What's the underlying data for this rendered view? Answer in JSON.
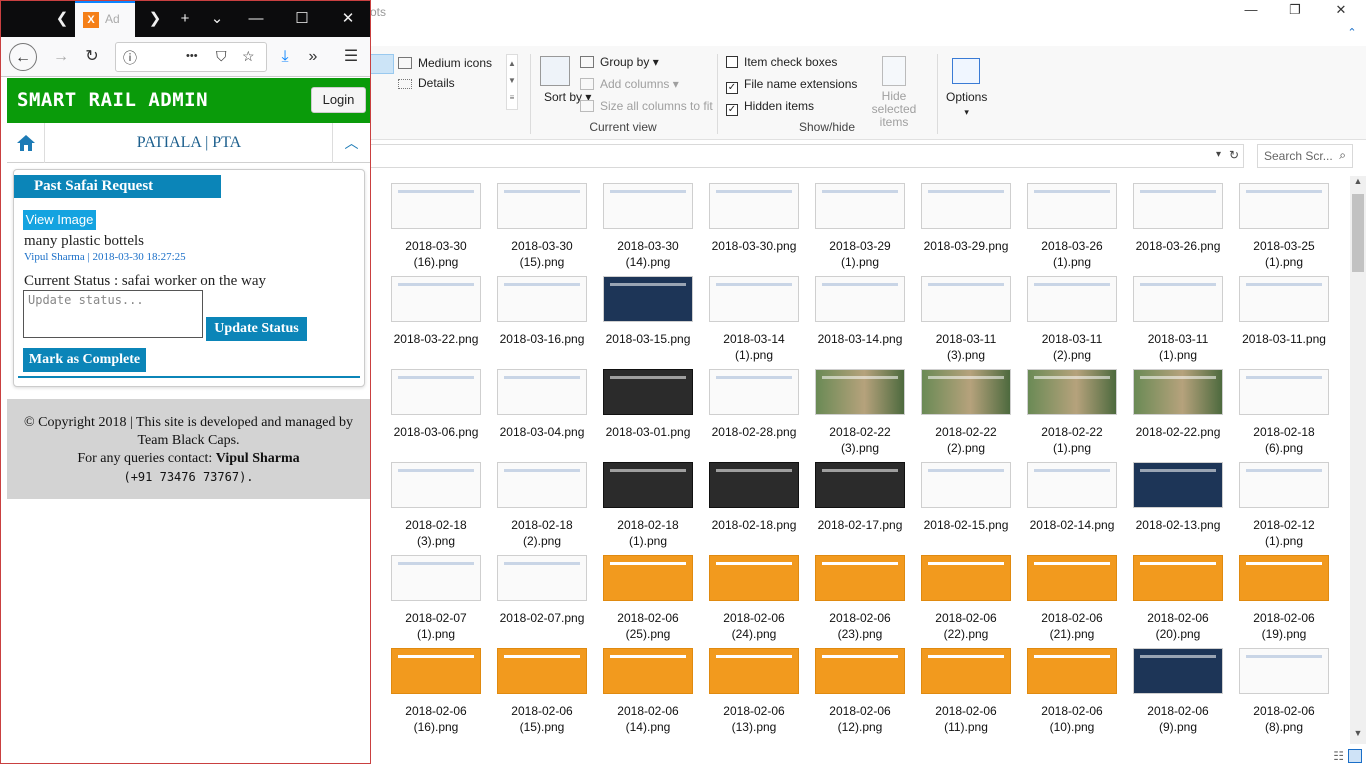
{
  "explorer": {
    "title_fragment": "ots",
    "window_controls": {
      "minimize": "—",
      "restore": "❐",
      "close": "✕"
    },
    "help_icon": "help-circle-icon",
    "ribbon": {
      "layout": {
        "medium_icons": "Medium icons",
        "details": "Details"
      },
      "current_view": {
        "sort_by": "Sort by",
        "group_by": "Group by",
        "add_columns": "Add columns",
        "size_columns": "Size all columns to fit",
        "label": "Current view"
      },
      "show_hide": {
        "item_check_boxes": {
          "label": "Item check boxes",
          "checked": false
        },
        "file_name_extensions": {
          "label": "File name extensions",
          "checked": true
        },
        "hidden_items": {
          "label": "Hidden items",
          "checked": true
        },
        "hide_selected": "Hide selected items",
        "label": "Show/hide"
      },
      "options": "Options"
    },
    "search_placeholder": "Search Scr...",
    "files": [
      [
        "2018-03-30 (16).png",
        "2018-03-30 (15).png",
        "2018-03-30 (14).png",
        "2018-03-30.png",
        "2018-03-29 (1).png",
        "2018-03-29.png",
        "2018-03-26 (1).png",
        "2018-03-26.png",
        "2018-03-25 (1).png"
      ],
      [
        "2018-03-22.png",
        "2018-03-16.png",
        "2018-03-15.png",
        "2018-03-14 (1).png",
        "2018-03-14.png",
        "2018-03-11 (3).png",
        "2018-03-11 (2).png",
        "2018-03-11 (1).png",
        "2018-03-11.png"
      ],
      [
        "2018-03-06.png",
        "2018-03-04.png",
        "2018-03-01.png",
        "2018-02-28.png",
        "2018-02-22 (3).png",
        "2018-02-22 (2).png",
        "2018-02-22 (1).png",
        "2018-02-22.png",
        "2018-02-18 (6).png"
      ],
      [
        "2018-02-18 (3).png",
        "2018-02-18 (2).png",
        "2018-02-18 (1).png",
        "2018-02-18.png",
        "2018-02-17.png",
        "2018-02-15.png",
        "2018-02-14.png",
        "2018-02-13.png",
        "2018-02-12 (1).png"
      ],
      [
        "2018-02-07 (1).png",
        "2018-02-07.png",
        "2018-02-06 (25).png",
        "2018-02-06 (24).png",
        "2018-02-06 (23).png",
        "2018-02-06 (22).png",
        "2018-02-06 (21).png",
        "2018-02-06 (20).png",
        "2018-02-06 (19).png"
      ],
      [
        "2018-02-06 (16).png",
        "2018-02-06 (15).png",
        "2018-02-06 (14).png",
        "2018-02-06 (13).png",
        "2018-02-06 (12).png",
        "2018-02-06 (11).png",
        "2018-02-06 (10).png",
        "2018-02-06 (9).png",
        "2018-02-06 (8).png"
      ]
    ],
    "thumb_styles": [
      [
        "doc",
        "doc",
        "doc",
        "doc",
        "doc",
        "doc",
        "doc",
        "doc",
        "doc"
      ],
      [
        "doc",
        "doc",
        "blue",
        "doc",
        "doc",
        "doc",
        "doc",
        "doc",
        "doc"
      ],
      [
        "doc",
        "doc",
        "dark",
        "doc",
        "photo",
        "photo",
        "photo",
        "photo",
        "doc"
      ],
      [
        "doc",
        "doc",
        "dark",
        "dark",
        "dark",
        "doc",
        "doc",
        "blue",
        "doc"
      ],
      [
        "doc",
        "doc",
        "orange",
        "orange",
        "orange",
        "orange",
        "orange",
        "orange",
        "orange"
      ],
      [
        "orange",
        "orange",
        "orange",
        "orange",
        "orange",
        "orange",
        "orange",
        "blue",
        "doc"
      ]
    ]
  },
  "browser": {
    "tab_title": "Ad",
    "tab_favicon": "X",
    "tab_controls": {
      "scroll_left": "❮",
      "scroll_right": "❯",
      "new_tab": "+",
      "list": "⌄",
      "minimize": "—",
      "maximize": "☐",
      "close": "✕"
    },
    "nav": {
      "back": "←",
      "forward": "→",
      "reload": "↻",
      "info": "ⓘ",
      "more": "•••",
      "pocket": "⛉",
      "star": "☆",
      "download": "⤓",
      "overflow": "»",
      "menu": "☰"
    }
  },
  "site": {
    "brand": "SMART RAIL ADMIN",
    "login": "Login",
    "location": "PATIALA | PTA",
    "card": {
      "title": "Past Safai Request",
      "view_image": "View Image",
      "description": "many plastic bottels",
      "meta": "Vipul Sharma | 2018-03-30 18:27:25",
      "current_status": "Current Status : safai worker on the way",
      "status_placeholder": "Update status...",
      "update_button": "Update Status",
      "complete_button": "Mark as Complete"
    },
    "footer": {
      "line1": "© Copyright 2018 | This site is developed and managed by Team Black Caps.",
      "line2_prefix": "For any queries contact: ",
      "line2_name": "Vipul Sharma",
      "line3": "(+91 73476 73767)."
    }
  }
}
